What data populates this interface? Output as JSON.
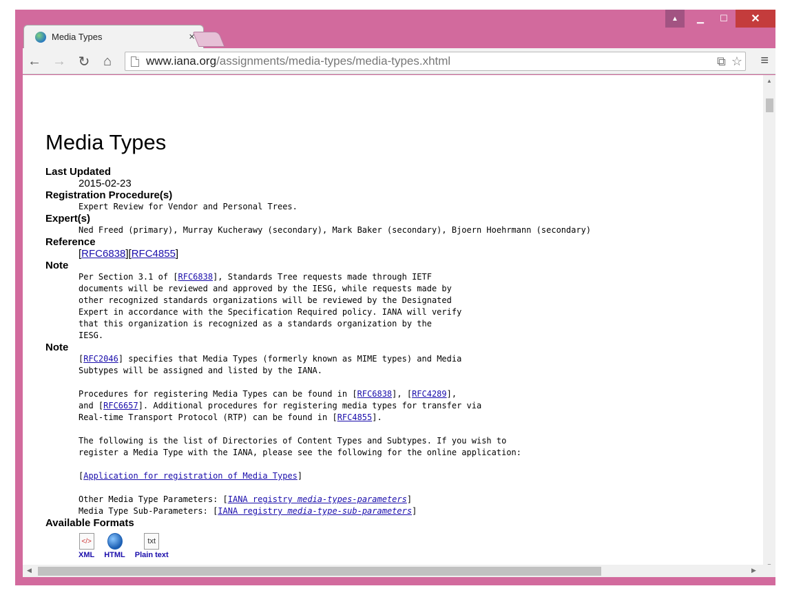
{
  "browser": {
    "tab_title": "Media Types",
    "tab_close": "×",
    "url_host": "www.iana.org",
    "url_path": "/assignments/media-types/media-types.xhtml",
    "icons": [
      "back-icon",
      "forward-icon",
      "reload-icon",
      "home-icon",
      "translate-icon",
      "star-icon",
      "menu-icon"
    ]
  },
  "page": {
    "title": "Media Types",
    "last_updated_label": "Last Updated",
    "last_updated": "2015-02-23",
    "procedure_label": "Registration Procedure(s)",
    "procedure": "Expert Review for Vendor and Personal Trees.",
    "experts_label": "Expert(s)",
    "experts": "Ned Freed (primary), Murray Kucherawy (secondary), Mark Baker (secondary), Bjoern Hoehrmann (secondary)",
    "reference_label": "Reference",
    "ref1": "RFC6838",
    "ref2": "RFC4855",
    "note_label": "Note",
    "note1": {
      "l1a": "Per Section 3.1 of [",
      "l1link": "RFC6838",
      "l1b": "], Standards Tree requests made through IETF",
      "l2": "documents will be reviewed and approved by the IESG, while requests made by",
      "l3": "other recognized standards organizations will be reviewed by the Designated",
      "l4": "Expert in accordance with the Specification Required policy. IANA will verify",
      "l5": "that this organization is recognized as a standards organization by the",
      "l6": "IESG."
    },
    "note2": {
      "p1l1link": "RFC2046",
      "p1l1b": "] specifies that Media Types (formerly known as MIME types) and Media",
      "p1l2": "Subtypes will be assigned and listed by the IANA.",
      "p2l1a": "Procedures for registering Media Types can be found in [",
      "p2link1": "RFC6838",
      "p2mid": "], [",
      "p2link2": "RFC4289",
      "p2l1end": "],",
      "p2l2a": "and [",
      "p2link3": "RFC6657",
      "p2l2b": "]. Additional procedures for registering media types for transfer via",
      "p2l3a": "Real-time Transport Protocol (RTP) can be found in [",
      "p2link4": "RFC4855",
      "p2l3b": "].",
      "p3l1": "The following is the list of Directories of Content Types and Subtypes. If you wish to",
      "p3l2": "register a Media Type with the IANA, please see the following for the online application:",
      "app_link": "Application for registration of Media Types",
      "params_label": "Other Media Type Parameters: [",
      "params_link_a": "IANA registry ",
      "params_link_b": "media-types-parameters",
      "subparams_label": "Media Type Sub-Parameters: [",
      "subparams_link_a": "IANA registry ",
      "subparams_link_b": "media-type-sub-parameters"
    },
    "formats_label": "Available Formats",
    "formats": [
      {
        "label": "XML",
        "icon": "xml-file-icon"
      },
      {
        "label": "HTML",
        "icon": "html-globe-icon"
      },
      {
        "label": "Plain text",
        "icon": "text-file-icon"
      }
    ]
  }
}
